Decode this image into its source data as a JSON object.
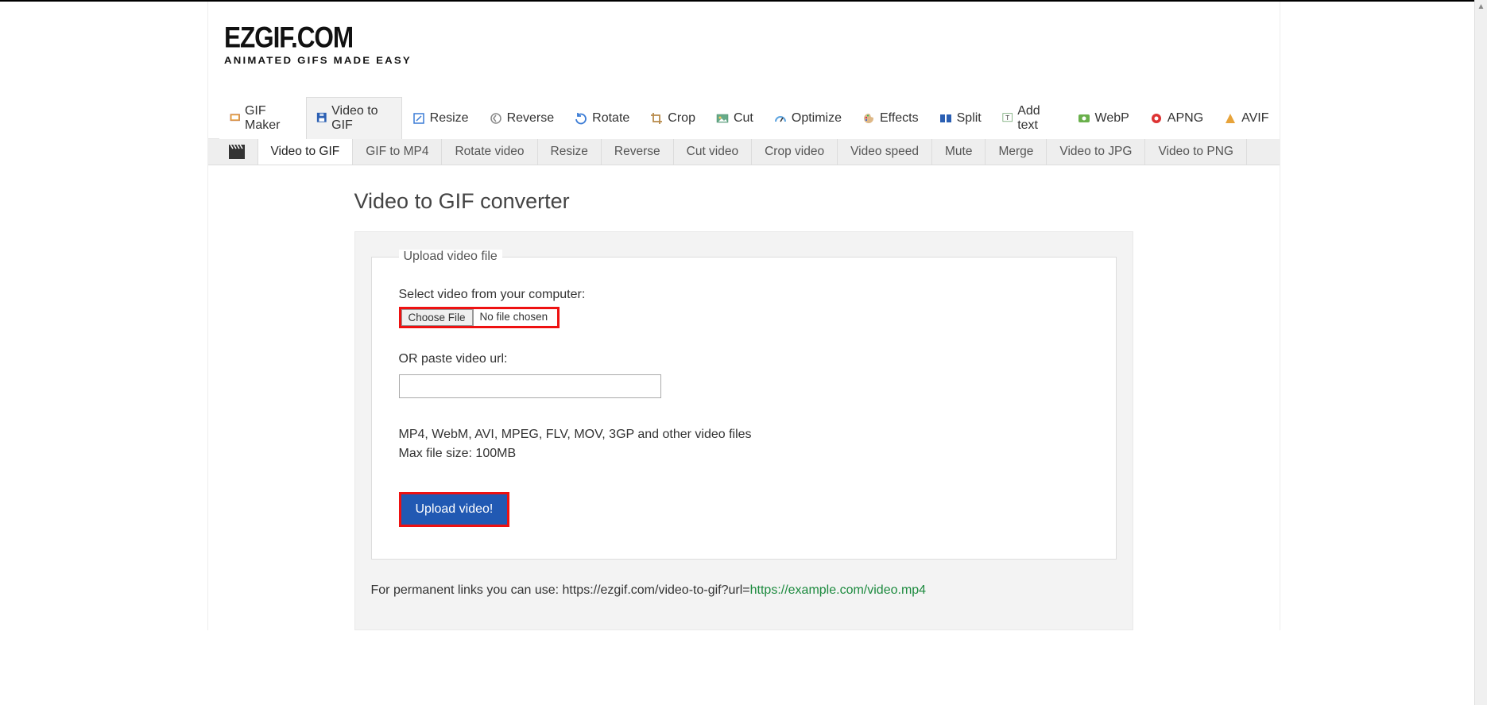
{
  "logo": {
    "title": "EZGIF.COM",
    "subtitle": "ANIMATED GIFS MADE EASY"
  },
  "nav_primary": [
    {
      "label": "GIF Maker"
    },
    {
      "label": "Video to GIF",
      "active": true
    },
    {
      "label": "Resize"
    },
    {
      "label": "Reverse"
    },
    {
      "label": "Rotate"
    },
    {
      "label": "Crop"
    },
    {
      "label": "Cut"
    },
    {
      "label": "Optimize"
    },
    {
      "label": "Effects"
    },
    {
      "label": "Split"
    },
    {
      "label": "Add text"
    },
    {
      "label": "WebP"
    },
    {
      "label": "APNG"
    },
    {
      "label": "AVIF"
    }
  ],
  "nav_secondary": [
    {
      "label": "Video to GIF",
      "active": true
    },
    {
      "label": "GIF to MP4"
    },
    {
      "label": "Rotate video"
    },
    {
      "label": "Resize"
    },
    {
      "label": "Reverse"
    },
    {
      "label": "Cut video"
    },
    {
      "label": "Crop video"
    },
    {
      "label": "Video speed"
    },
    {
      "label": "Mute"
    },
    {
      "label": "Merge"
    },
    {
      "label": "Video to JPG"
    },
    {
      "label": "Video to PNG"
    }
  ],
  "page": {
    "title": "Video to GIF converter",
    "upload_legend": "Upload video file",
    "select_label": "Select video from your computer:",
    "choose_file_label": "Choose File",
    "no_file_chosen": "No file chosen",
    "or_paste_label": "OR paste video url:",
    "url_value": "",
    "formats_help": "MP4, WebM, AVI, MPEG, FLV, MOV, 3GP and other video files",
    "maxsize_help": "Max file size: 100MB",
    "upload_button": "Upload video!",
    "permalink_prefix": "For permanent links you can use: https://ezgif.com/video-to-gif?url=",
    "permalink_example": "https://example.com/video.mp4"
  },
  "icons": {
    "gif_maker": "#e8a13a",
    "video": "#2b5fb3",
    "resize": "#3a7bd5",
    "reverse": "#888",
    "rotate": "#3a7bd5",
    "crop": "#b78a4a",
    "cut": "#6a8",
    "optimize": "#5da4e0",
    "effects": "#c05",
    "split": "#2b5fb3",
    "addtext": "#7a7",
    "webp": "#6ab04c",
    "apng": "#d33",
    "avif": "#e7a33a"
  }
}
